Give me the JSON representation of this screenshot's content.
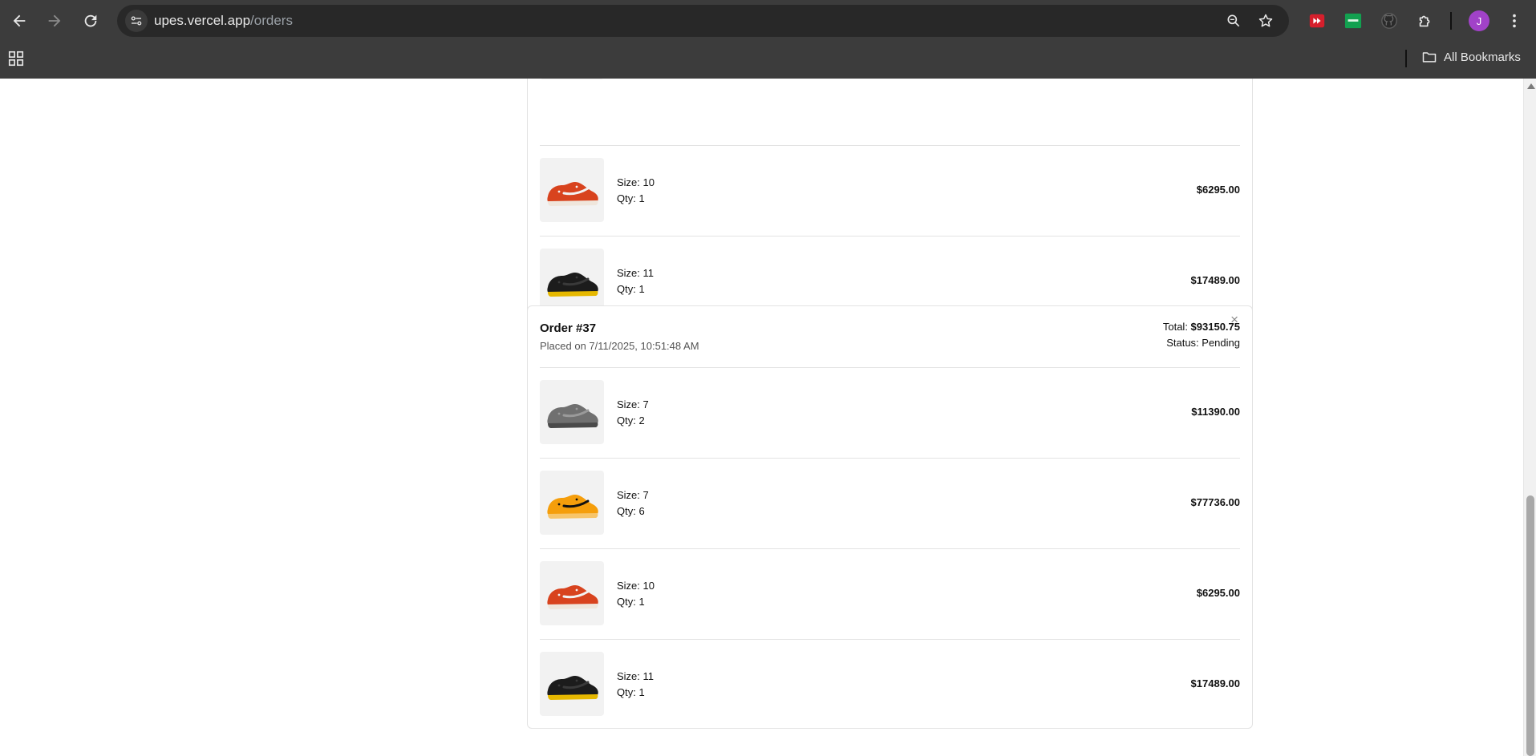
{
  "browser": {
    "url_host": "upes.vercel.app",
    "url_path": "/orders",
    "avatar_letter": "J",
    "bookmarks_label": "All Bookmarks"
  },
  "orders": [
    {
      "items": [
        {
          "size": "Size: 10",
          "qty": "Qty: 1",
          "price": "$6295.00",
          "shoe": "red"
        },
        {
          "size": "Size: 11",
          "qty": "Qty: 1",
          "price": "$17489.00",
          "shoe": "black"
        }
      ]
    },
    {
      "title": "Order #37",
      "placed": "Placed on 7/11/2025, 10:51:48 AM",
      "total_label": "Total: ",
      "total_value": "$93150.75",
      "status": "Status: Pending",
      "close_glyph": "×",
      "items": [
        {
          "size": "Size: 7",
          "qty": "Qty: 2",
          "price": "$11390.00",
          "shoe": "gray"
        },
        {
          "size": "Size: 7",
          "qty": "Qty: 6",
          "price": "$77736.00",
          "shoe": "orange"
        },
        {
          "size": "Size: 10",
          "qty": "Qty: 1",
          "price": "$6295.00",
          "shoe": "red"
        },
        {
          "size": "Size: 11",
          "qty": "Qty: 1",
          "price": "$17489.00",
          "shoe": "black"
        }
      ]
    }
  ],
  "shoe_colors": {
    "red": {
      "upper": "#d8431e",
      "accent": "#f2f2f2",
      "sole": "#efe6dc"
    },
    "black": {
      "upper": "#1c1c1c",
      "accent": "#3a3a3a",
      "sole": "#e6b800"
    },
    "gray": {
      "upper": "#707070",
      "accent": "#9a9a9a",
      "sole": "#4a4a4a"
    },
    "orange": {
      "upper": "#f59e0b",
      "accent": "#111111",
      "sole": "#f7c56a"
    }
  }
}
